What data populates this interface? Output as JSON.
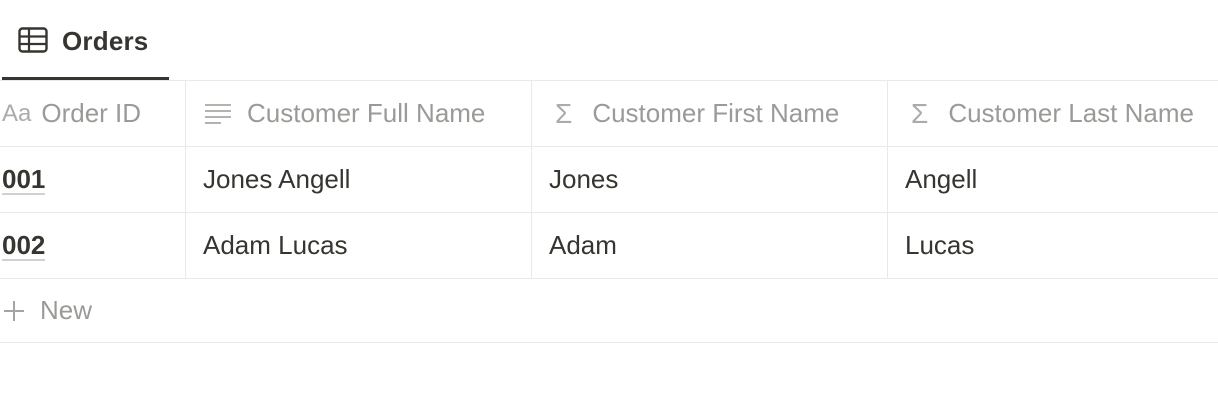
{
  "tab": {
    "label": "Orders",
    "icon": "table-icon"
  },
  "columns": [
    {
      "label": "Order ID",
      "icon": "text-aa-icon"
    },
    {
      "label": "Customer Full Name",
      "icon": "text-lines-icon"
    },
    {
      "label": "Customer First Name",
      "icon": "formula-sigma-icon"
    },
    {
      "label": "Customer Last Name",
      "icon": "formula-sigma-icon"
    }
  ],
  "rows": [
    {
      "order_id": "001",
      "full_name": "Jones Angell",
      "first_name": "Jones",
      "last_name": "Angell"
    },
    {
      "order_id": "002",
      "full_name": "Adam Lucas",
      "first_name": "Adam",
      "last_name": "Lucas"
    }
  ],
  "new_row": {
    "label": "New"
  },
  "icons": {
    "aa": "Aa",
    "sigma": "Σ"
  }
}
